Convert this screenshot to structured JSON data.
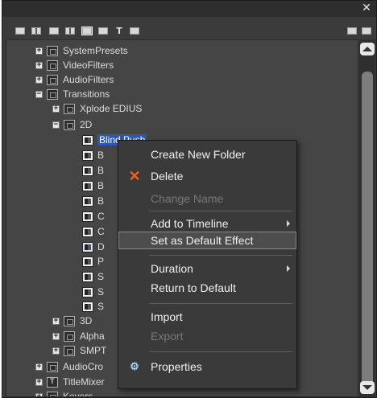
{
  "window": {
    "close_glyph": "✕"
  },
  "toolbar": {
    "buttons": [
      {
        "icon": "view-list-icon"
      },
      {
        "icon": "view-details-icon"
      },
      {
        "icon": "view-thumbnail-icon"
      },
      {
        "icon": "view-large-icon"
      },
      {
        "icon": "view-selected-icon"
      },
      {
        "icon": "view-small-icon"
      },
      {
        "icon": "text-icon",
        "glyph": "T"
      },
      {
        "icon": "folder-view-icon"
      }
    ],
    "right_buttons": [
      {
        "icon": "panel-icon"
      },
      {
        "icon": "lock-icon"
      }
    ]
  },
  "tree": {
    "items": [
      {
        "label": "SystemPresets",
        "expander": "+"
      },
      {
        "label": "VideoFilters",
        "expander": "+"
      },
      {
        "label": "AudioFilters",
        "expander": "+"
      },
      {
        "label": "Transitions",
        "expander": "−"
      },
      {
        "label": "Xplode EDIUS",
        "expander": "+"
      },
      {
        "label": "2D",
        "expander": "−"
      },
      {
        "label": "Blind Push"
      },
      {
        "label": "B"
      },
      {
        "label": "B"
      },
      {
        "label": "B"
      },
      {
        "label": "B"
      },
      {
        "label": "C"
      },
      {
        "label": "C"
      },
      {
        "label": "D"
      },
      {
        "label": "P"
      },
      {
        "label": "S"
      },
      {
        "label": "S"
      },
      {
        "label": "S"
      },
      {
        "label": "3D",
        "expander": "+"
      },
      {
        "label": "Alpha",
        "expander": "+"
      },
      {
        "label": "SMPT",
        "expander": "+"
      },
      {
        "label": "AudioCro",
        "expander": "+"
      },
      {
        "label": "TitleMixer",
        "expander": "+"
      },
      {
        "label": "Keyers",
        "expander": "+"
      }
    ]
  },
  "context_menu": {
    "items": [
      {
        "label": "Create New Folder",
        "enabled": true
      },
      {
        "label": "Delete",
        "enabled": true,
        "icon": "delete-x-icon",
        "glyph": "✕"
      },
      {
        "label": "Change Name",
        "enabled": false
      },
      {
        "label": "Add to Timeline",
        "enabled": true,
        "submenu": true
      },
      {
        "label": "Set as Default Effect",
        "enabled": true,
        "highlighted": true
      },
      {
        "label": "Duration",
        "enabled": true,
        "submenu": true
      },
      {
        "label": "Return to Default",
        "enabled": true
      },
      {
        "label": "Import",
        "enabled": true
      },
      {
        "label": "Export",
        "enabled": false
      },
      {
        "label": "Properties",
        "enabled": true,
        "icon": "properties-icon",
        "glyph": "⚙"
      }
    ]
  },
  "colors": {
    "panel_bg": "#3b3b3b",
    "selection": "#2b58b8",
    "delete_icon": "#ff5a1a",
    "disabled_text": "#787878"
  }
}
